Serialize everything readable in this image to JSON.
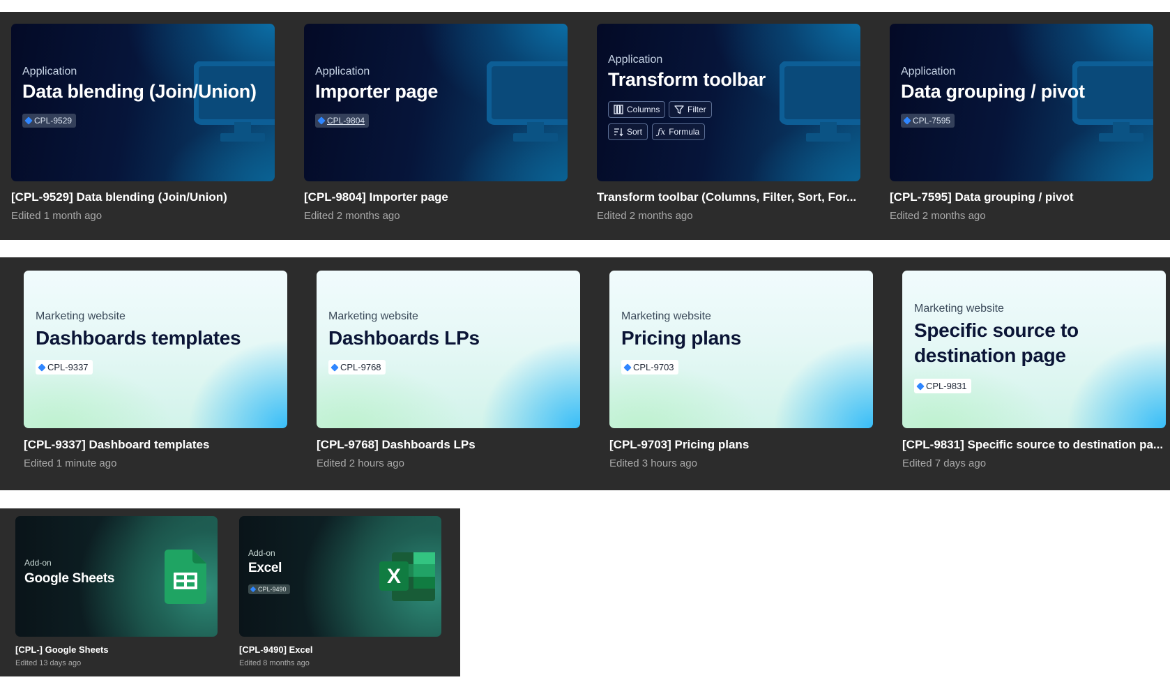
{
  "colors": {
    "row_background": "#2c2c2c",
    "page_background": "#ffffff",
    "jira_badge": "#2f86ff",
    "sheets_green": "#1fa463",
    "excel_green": "#107c41"
  },
  "rows": [
    {
      "cards": [
        {
          "kicker": "Application",
          "heading": "Data blending (Join/Union)",
          "tag": "CPL-9529",
          "title": "[CPL-9529] Data blending (Join/Union)",
          "edited": "Edited 1 month ago",
          "icon": "monitor-icon"
        },
        {
          "kicker": "Application",
          "heading": "Importer page",
          "tag": "CPL-9804",
          "title": "[CPL-9804] Importer page",
          "edited": "Edited 2 months ago",
          "icon": "monitor-icon"
        },
        {
          "kicker": "Application",
          "heading": "Transform toolbar",
          "chips": [
            {
              "label": "Columns",
              "icon": "columns-icon"
            },
            {
              "label": "Filter",
              "icon": "filter-icon"
            },
            {
              "label": "Sort",
              "icon": "sort-icon"
            },
            {
              "label": "Formula",
              "icon": "formula-icon"
            }
          ],
          "title": "Transform toolbar (Columns, Filter, Sort, For...",
          "edited": "Edited 2 months ago",
          "icon": "monitor-icon"
        },
        {
          "kicker": "Application",
          "heading": "Data grouping / pivot",
          "tag": "CPL-7595",
          "title": "[CPL-7595] Data grouping / pivot",
          "edited": "Edited 2 months ago",
          "icon": "monitor-icon"
        }
      ]
    },
    {
      "cards": [
        {
          "kicker": "Marketing website",
          "heading": "Dashboards templates",
          "tag": "CPL-9337",
          "title": "[CPL-9337] Dashboard templates",
          "edited": "Edited 1 minute ago"
        },
        {
          "kicker": "Marketing website",
          "heading": "Dashboards LPs",
          "tag": "CPL-9768",
          "title": "[CPL-9768] Dashboards LPs",
          "edited": "Edited 2 hours ago"
        },
        {
          "kicker": "Marketing website",
          "heading": "Pricing plans",
          "tag": "CPL-9703",
          "title": "[CPL-9703] Pricing plans",
          "edited": "Edited 3 hours ago"
        },
        {
          "kicker": "Marketing website",
          "heading_line1": "Specific source to",
          "heading_line2": "destination page",
          "tag": "CPL-9831",
          "title": "[CPL-9831] Specific source to destination pa...",
          "edited": "Edited 7 days ago"
        }
      ]
    },
    {
      "cards": [
        {
          "kicker": "Add-on",
          "heading": "Google Sheets",
          "title": "[CPL-] Google Sheets",
          "edited": "Edited 13 days ago",
          "icon": "google-sheets-icon"
        },
        {
          "kicker": "Add-on",
          "heading": "Excel",
          "tag": "CPL-9490",
          "title": "[CPL-9490] Excel",
          "edited": "Edited 8 months ago",
          "icon": "excel-icon"
        }
      ]
    }
  ]
}
